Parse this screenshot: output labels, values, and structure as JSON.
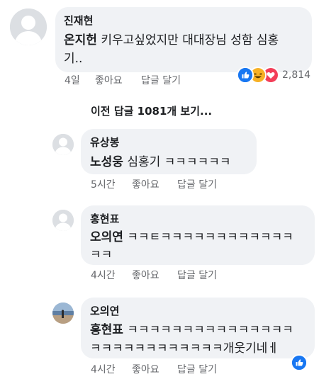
{
  "comments": [
    {
      "author": "진재현",
      "mention": "온지헌",
      "text_line1": "키우고싶었지만 대대장님 성함 심홍",
      "text_line2": "기..",
      "time": "4일",
      "like_label": "좋아요",
      "reply_label": "답글 달기",
      "reactions": {
        "types": [
          "like-icon",
          "haha-icon",
          "love-icon"
        ],
        "count": "2,814"
      }
    }
  ],
  "view_previous_replies": "이전 답글 1081개 보기...",
  "replies": [
    {
      "author": "유상봉",
      "mention": "노성웅",
      "text_line1": "심홍기 ㅋㅋㅋㅋㅋㅋ",
      "time": "5시간",
      "like_label": "좋아요",
      "reply_label": "답글 달기"
    },
    {
      "author": "홍현표",
      "mention": "오의연",
      "text_line1": "ㅋㅋㅌㅋㅋㅋㅋㅋㅋㅋㅋㅋㅋㅋㅋ",
      "text_line2": "ㅋㅋ",
      "time": "4시간",
      "like_label": "좋아요",
      "reply_label": "답글 달기"
    },
    {
      "author": "오의연",
      "mention": "홍현표",
      "text_line1": "ㅋㅋㅋㅋㅋㅋㅋㅋㅋㅋㅋㅋㅋㅋㅋ",
      "text_line2": "ㅋㅋㅋㅋㅋㅋㅋㅋㅋㅋㅋㅋ개웃기네ㅔ",
      "time": "4시간",
      "like_label": "좋아요",
      "reply_label": "답글 달기",
      "reactions": {
        "types": [
          "like-icon"
        ]
      }
    }
  ],
  "colors": {
    "bubble": "#f0f2f5",
    "meta": "#65676b",
    "like_blue": "#1877f2",
    "love_red": "#f33e58",
    "haha_yellow": "#f7b125"
  }
}
